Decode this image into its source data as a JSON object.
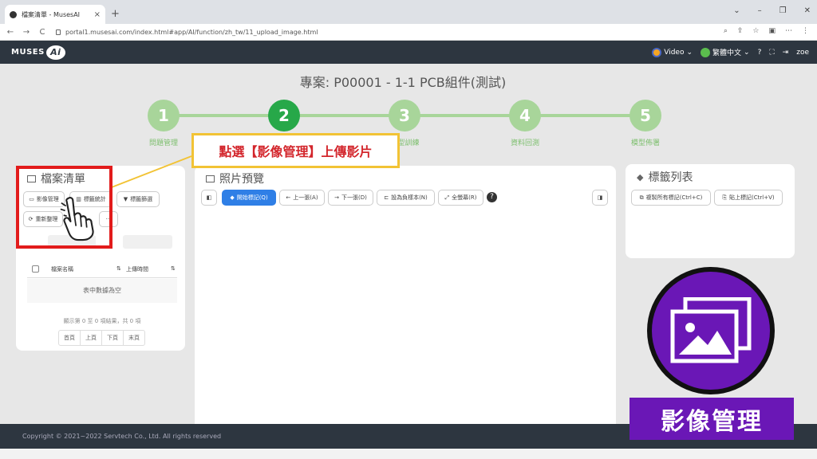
{
  "browser": {
    "tab_title": "檔案清單 - MusesAI",
    "tab_close": "×",
    "new_tab": "+",
    "url": "portal1.musesai.com/index.html#app/AI/function/zh_tw/11_upload_image.html",
    "window_buttons": [
      "⌄",
      "–",
      "❐",
      "✕"
    ],
    "nav_buttons": [
      "←",
      "→",
      "C"
    ]
  },
  "header": {
    "logo_text": "MUSES",
    "logo_ai": "Ai",
    "video_label": "Video",
    "language_label": "繁體中文",
    "user": "zoe",
    "icons": [
      "help-icon",
      "fullscreen-icon",
      "logout-icon"
    ]
  },
  "project_title": "專案: P00001 - 1-1 PCB組件(測試)",
  "steps": [
    {
      "num": "1",
      "label": "問題管理"
    },
    {
      "num": "2",
      "label": ""
    },
    {
      "num": "3",
      "label": "型訓練"
    },
    {
      "num": "4",
      "label": "資料回測"
    },
    {
      "num": "5",
      "label": "模型佈署"
    }
  ],
  "file_panel": {
    "title": "檔案清單",
    "buttons": [
      "影像管理",
      "標籤統計",
      "標籤篩選",
      "重新整理"
    ],
    "more": "···",
    "table_headers": [
      "檔案名稱",
      "上傳時間"
    ],
    "empty_text": "表中數據為空",
    "info_text": "顯示第 0 至 0 項結果，共 0 項",
    "pager": [
      "首頁",
      "上頁",
      "下頁",
      "末頁"
    ]
  },
  "preview_panel": {
    "title": "照片預覽",
    "buttons": [
      "開始標記(Q)",
      "上一張(A)",
      "下一張(D)",
      "設為負樣本(N)",
      "全螢幕(R)"
    ],
    "help": "?"
  },
  "label_panel": {
    "title": "標籤列表",
    "buttons": [
      "複製所有標記(Ctrl+C)",
      "貼上標記(Ctrl+V)"
    ]
  },
  "footer": "Copyright © 2021~2022 Servtech Co., Ltd. All rights reserved",
  "tutorial": {
    "callout": "點選【影像管理】上傳影片",
    "badge_label": "影像管理"
  },
  "colors": {
    "header": "#2d3640",
    "step_active": "#27a849",
    "step_inactive": "#a8d59a",
    "primary_button": "#2f7fe6",
    "callout_border": "#f2c335",
    "highlight_red": "#e21b1b",
    "badge_purple": "#6a17b6"
  }
}
